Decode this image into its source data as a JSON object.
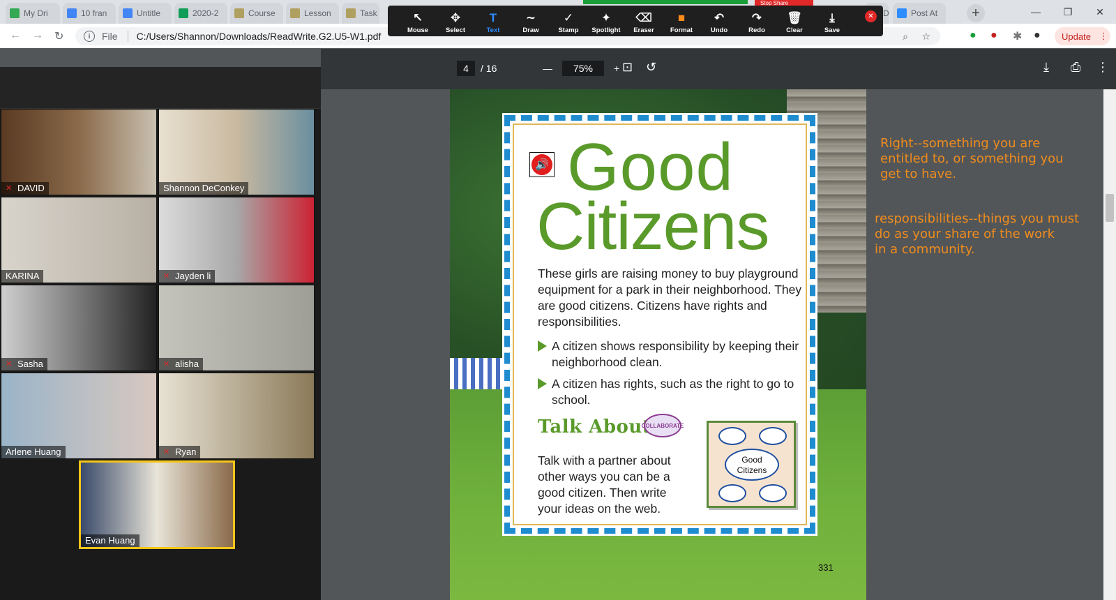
{
  "browser": {
    "tabs": [
      {
        "label": "My Dri",
        "fav": "#34a853"
      },
      {
        "label": "10 fran",
        "fav": "#4285f4"
      },
      {
        "label": "Untitle",
        "fav": "#4285f4"
      },
      {
        "label": "2020-2",
        "fav": "#0f9d58"
      },
      {
        "label": "Course",
        "fav": "#b0a060"
      },
      {
        "label": "Lesson",
        "fav": "#b0a060"
      },
      {
        "label": "Task l",
        "fav": "#b0a060"
      },
      {
        "label": "DAT",
        "fav": "#888"
      },
      {
        "label": "Post At",
        "fav": "#2d8cff"
      }
    ],
    "new_tab": "+",
    "address": {
      "scheme": "File",
      "url": "C:/Users/Shannon/Downloads/ReadWrite.G2.U5-W1.pdf"
    },
    "update_label": "Update",
    "window_controls": [
      "—",
      "❐",
      "✕"
    ]
  },
  "zoom_share": {
    "stop_share": "Stop Share"
  },
  "annotation_toolbar": {
    "tools": [
      {
        "label": "Mouse",
        "icon": "↖"
      },
      {
        "label": "Select",
        "icon": "✥"
      },
      {
        "label": "Text",
        "icon": "T",
        "active": true
      },
      {
        "label": "Draw",
        "icon": "∼"
      },
      {
        "label": "Stamp",
        "icon": "✓"
      },
      {
        "label": "Spotlight",
        "icon": "✦"
      },
      {
        "label": "Eraser",
        "icon": "⌫"
      },
      {
        "label": "Format",
        "icon": "■"
      },
      {
        "label": "Undo",
        "icon": "↶"
      },
      {
        "label": "Redo",
        "icon": "↷"
      },
      {
        "label": "Clear",
        "icon": "🗑"
      },
      {
        "label": "Save",
        "icon": "⤓"
      }
    ],
    "format_color": "#ff8c1a"
  },
  "pdf_viewer": {
    "page_current": "4",
    "page_total": "/ 16",
    "zoom": "75%"
  },
  "page": {
    "title_line1": "Good",
    "title_line2": "Citizens",
    "intro": "These girls are raising money to buy playground equipment for a park in their neighborhood. They are good citizens. Citizens have rights and responsibilities.",
    "bullets": [
      "A citizen shows responsibility by keeping their neighborhood clean.",
      "A citizen has rights, such as the right to go to school."
    ],
    "talk_heading": "Talk About It",
    "collab_badge": "COLLABORATE",
    "talk_text": "Talk with a partner about other ways you can be a good citizen. Then write your ideas on the web.",
    "web_center": "Good Citizens",
    "page_number": "331"
  },
  "notes": {
    "note1": "Right--something you are\nentitled to, or something you\nget to have.",
    "note2": "responsibilities--things you must\ndo as your share of the work\nin a community.",
    "color": "#f08c1c"
  },
  "participants": [
    {
      "name": "DAVID",
      "muted": true
    },
    {
      "name": "Shannon DeConkey",
      "muted": false
    },
    {
      "name": "KARINA",
      "muted": false
    },
    {
      "name": "Jayden li",
      "muted": true
    },
    {
      "name": "Sasha",
      "muted": true
    },
    {
      "name": "alisha",
      "muted": true
    },
    {
      "name": "Arlene Huang",
      "muted": false
    },
    {
      "name": "Ryan",
      "muted": true
    },
    {
      "name": "Evan Huang",
      "muted": false,
      "speaking": true
    }
  ]
}
